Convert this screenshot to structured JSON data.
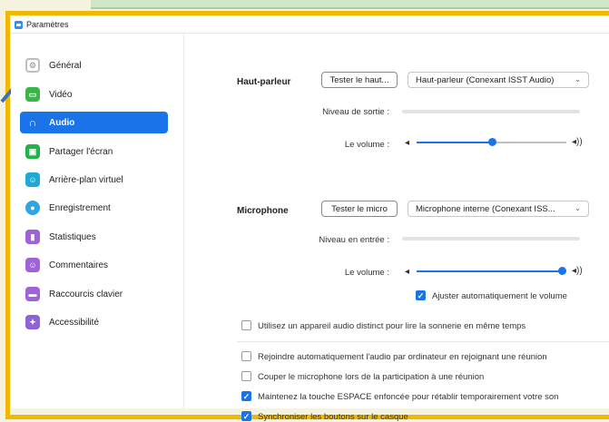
{
  "window": {
    "title": "Paramètres"
  },
  "sidebar": {
    "items": [
      {
        "label": "Général",
        "icon": "gear-icon",
        "color": "#bdbdbd"
      },
      {
        "label": "Vidéo",
        "icon": "video-icon",
        "color": "#3bb54a"
      },
      {
        "label": "Audio",
        "icon": "headphones-icon",
        "color": "#1a73e8",
        "active": true
      },
      {
        "label": "Partager l'écran",
        "icon": "share-screen-icon",
        "color": "#21b24a"
      },
      {
        "label": "Arrière-plan virtuel",
        "icon": "virtual-background-icon",
        "color": "#1fa9d6"
      },
      {
        "label": "Enregistrement",
        "icon": "record-icon",
        "color": "#2ea6e6"
      },
      {
        "label": "Statistiques",
        "icon": "statistics-icon",
        "color": "#9e63d8"
      },
      {
        "label": "Commentaires",
        "icon": "feedback-icon",
        "color": "#9e63d8"
      },
      {
        "label": "Raccourcis clavier",
        "icon": "keyboard-icon",
        "color": "#9e63d8"
      },
      {
        "label": "Accessibilité",
        "icon": "accessibility-icon",
        "color": "#8e63d8"
      }
    ]
  },
  "speaker": {
    "label": "Haut-parleur",
    "test_button": "Tester le haut...",
    "device": "Haut-parleur (Conexant ISST Audio)",
    "output_level_label": "Niveau de sortie :",
    "volume_label": "Le volume :",
    "volume_level": 0.5
  },
  "microphone": {
    "label": "Microphone",
    "test_button": "Tester le micro",
    "device": "Microphone interne (Conexant ISS...",
    "input_level_label": "Niveau en entrée :",
    "volume_label": "Le volume :",
    "volume_level": 0.97,
    "auto_adjust": {
      "label": "Ajuster automatiquement le volume",
      "checked": true
    }
  },
  "options": [
    {
      "label": "Utilisez un appareil audio distinct pour lire la sonnerie en même temps",
      "checked": false
    },
    {
      "label": "Rejoindre automatiquement l'audio par ordinateur en rejoignant une réunion",
      "checked": false
    },
    {
      "label": "Couper le microphone lors de la participation à une réunion",
      "checked": false
    },
    {
      "label": "Maintenez la touche ESPACE enfoncée pour rétablir temporairement votre son",
      "checked": true
    },
    {
      "label": "Synchroniser les boutons sur le casque",
      "checked": true
    }
  ],
  "colors": {
    "accent": "#1a73e8",
    "highlight_frame": "#f0b800",
    "arrow": "#3c6fb4"
  }
}
